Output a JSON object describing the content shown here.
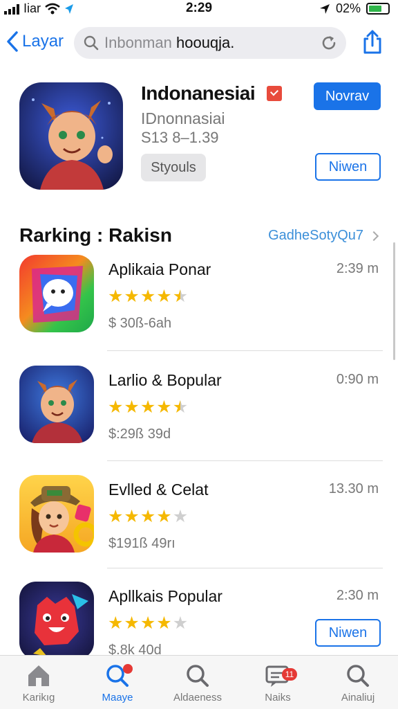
{
  "status_bar": {
    "carrier": "Iiar",
    "time": "2:29",
    "battery": "02%"
  },
  "nav": {
    "back_label": "Layar",
    "search_placeholder": "Inbonman",
    "search_query": "hoouqja."
  },
  "hero": {
    "title": "Indonanesiai",
    "subtitle": "IDnonnasiai",
    "price": "S13 8–1.39",
    "tag": "Styouls",
    "primary_button": "Novrav",
    "secondary_button": "Niwen"
  },
  "section": {
    "title": "Rarking : Rakisn",
    "link": "GadheSotyQu7"
  },
  "apps": [
    {
      "name": "Aplikaia Ponar",
      "time": "2:39 m",
      "price": "$ 30ß-6ah",
      "rating": 4.5
    },
    {
      "name": "Larlio & Bopular",
      "time": "0:90 m",
      "price": "$:29ß 39d",
      "rating": 4.5
    },
    {
      "name": "Evlled & Celat",
      "time": "13.30 m",
      "price": "$191ß 49rı",
      "rating": 4.0
    },
    {
      "name": "Apllkais Popular",
      "time": "2:30 m",
      "price": "$.8k 40d",
      "rating": 4.0,
      "button": "Niwen"
    }
  ],
  "tabs": [
    {
      "label": "Karikıg",
      "icon": "home-icon"
    },
    {
      "label": "Maaye",
      "icon": "search-icon",
      "active": true
    },
    {
      "label": "Aldaeness",
      "icon": "search-icon"
    },
    {
      "label": "Naiks",
      "icon": "chat-icon",
      "badge": "11"
    },
    {
      "label": "Ainaliuj",
      "icon": "search-icon"
    }
  ],
  "colors": {
    "accent": "#1a73e8",
    "star": "#f5b800",
    "badge": "#e53935"
  }
}
